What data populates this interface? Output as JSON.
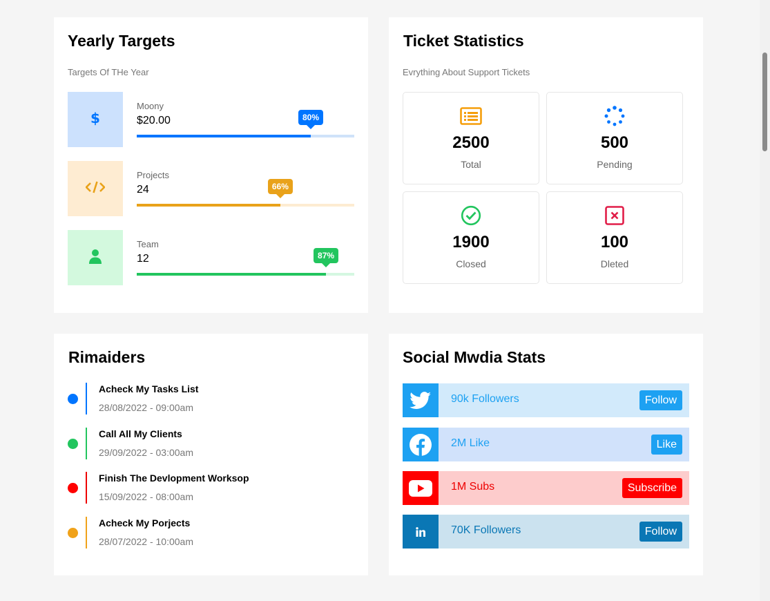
{
  "colors": {
    "blue": "#0075ff",
    "orange": "#f59e0b",
    "green": "#22c55e",
    "red": "#f44336"
  },
  "yearly_targets": {
    "title": "Yearly Targets",
    "subtitle": "Targets Of THe Year",
    "items": [
      {
        "icon": "dollar-icon",
        "label": "Moony",
        "value": "$20.00",
        "percent": 80,
        "badge": "80%",
        "color": "#0075ff",
        "track": "#cfe2f9",
        "icon_bg": "#cce1fd"
      },
      {
        "icon": "code-icon",
        "label": "Projects",
        "value": "24",
        "percent": 66,
        "badge": "66%",
        "color": "#e9a21a",
        "track": "#fdecd2",
        "icon_bg": "#feecd2"
      },
      {
        "icon": "user-icon",
        "label": "Team",
        "value": "12",
        "percent": 87,
        "badge": "87%",
        "color": "#22c55e",
        "track": "#d5f7e1",
        "icon_bg": "#d3f9de"
      }
    ]
  },
  "ticket_statistics": {
    "title": "Ticket Statistics",
    "subtitle": "Evrything About Support Tickets",
    "boxes": [
      {
        "icon": "list-icon",
        "number": "2500",
        "label": "Total"
      },
      {
        "icon": "spinner-icon",
        "number": "500",
        "label": "Pending"
      },
      {
        "icon": "check-circle-icon",
        "number": "1900",
        "label": "Closed"
      },
      {
        "icon": "x-square-icon",
        "number": "100",
        "label": "Dleted"
      }
    ]
  },
  "reminders": {
    "title": "Rimaiders",
    "items": [
      {
        "title": "Acheck My Tasks List",
        "date": "28/08/2022 - 09:00am",
        "color": "#0075ff"
      },
      {
        "title": "Call All My Clients",
        "date": "29/09/2022 - 03:00am",
        "color": "#22c55e"
      },
      {
        "title": "Finish The Devlopment Worksop",
        "date": "15/09/2022 - 08:00am",
        "color": "#f00"
      },
      {
        "title": "Acheck My Porjects",
        "date": "28/07/2022 - 10:00am",
        "color": "#f0a21a"
      }
    ]
  },
  "social": {
    "title": "Social Mwdia Stats",
    "items": [
      {
        "icon": "twitter-icon",
        "text": "90k Followers",
        "button": "Follow",
        "color": "#1da1f2",
        "bg": "#d2eafb"
      },
      {
        "icon": "facebook-icon",
        "text": "2M Like",
        "button": "Like",
        "color": "#1877f2",
        "bg": "#d1e2fb"
      },
      {
        "icon": "youtube-icon",
        "text": "1M Subs",
        "button": "Subscribe",
        "color": "#f00",
        "bg": "#fdcccc"
      },
      {
        "icon": "linkedin-icon",
        "text": "70K Followers",
        "button": "Follow",
        "color": "#0a66c2",
        "bg": "#cbe2ef"
      }
    ]
  }
}
